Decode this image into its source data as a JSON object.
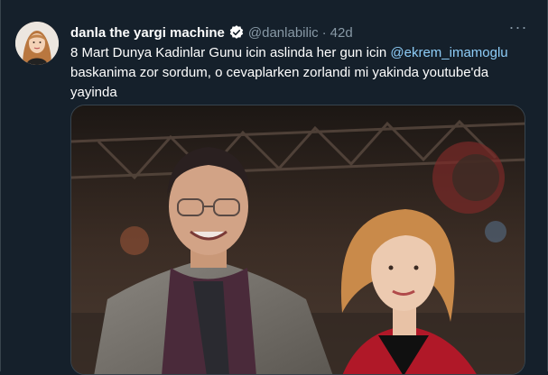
{
  "tweet": {
    "display_name": "danla the yargi machine",
    "handle": "@danlabilic",
    "separator": "·",
    "time": "42d",
    "more_label": "···",
    "text_before": "8 Mart Dunya Kadinlar Gunu icin aslinda her gun icin ",
    "mention": "@ekrem_imamoglu",
    "text_after": " baskanima zor sordum, o cevaplarken zorlandi mi yakinda youtube'da yayinda"
  },
  "colors": {
    "background": "#15202b",
    "accent": "#1da1f2",
    "mention": "#8ecdf8",
    "secondary_text": "#8899a6",
    "border": "#38444d"
  },
  "icons": {
    "verified": "verified-badge-icon",
    "more": "more-options-icon"
  }
}
